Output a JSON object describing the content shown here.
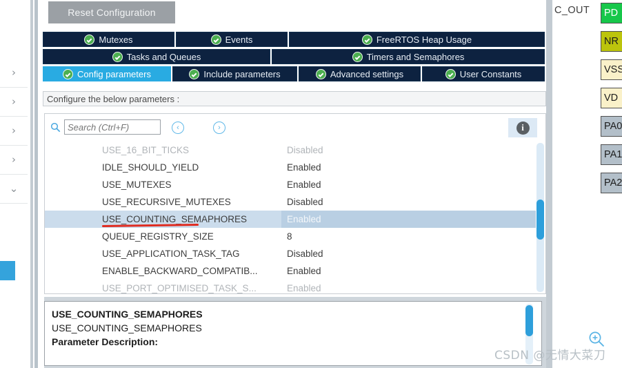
{
  "window": {
    "app": "STM32CubeMX FreeRTOS Configuration"
  },
  "toolbar": {
    "reset_label": "Reset Configuration"
  },
  "tabs": {
    "row1": [
      {
        "label": "Mutexes",
        "icon": "check-circle-icon",
        "active": false
      },
      {
        "label": "Events",
        "icon": "check-circle-icon",
        "active": false
      },
      {
        "label": "FreeRTOS Heap Usage",
        "icon": "check-circle-icon",
        "active": false
      }
    ],
    "row2": [
      {
        "label": "Tasks and Queues",
        "icon": "check-circle-icon",
        "active": false
      },
      {
        "label": "Timers and Semaphores",
        "icon": "check-circle-icon",
        "active": false
      }
    ],
    "row3": [
      {
        "label": "Config parameters",
        "icon": "check-circle-icon",
        "active": true
      },
      {
        "label": "Include parameters",
        "icon": "check-circle-icon",
        "active": false
      },
      {
        "label": "Advanced settings",
        "icon": "check-circle-icon",
        "active": false
      },
      {
        "label": "User Constants",
        "icon": "check-circle-icon",
        "active": false
      }
    ]
  },
  "configure_strip": {
    "text": "Configure the below parameters :"
  },
  "search": {
    "placeholder": "Search (Ctrl+F)",
    "prev_icon": "‹",
    "next_icon": "›",
    "info_icon": "i"
  },
  "parameters": [
    {
      "name": "USE_16_BIT_TICKS",
      "value": "Disabled",
      "state": "dim"
    },
    {
      "name": "IDLE_SHOULD_YIELD",
      "value": "Enabled",
      "state": "normal"
    },
    {
      "name": "USE_MUTEXES",
      "value": "Enabled",
      "state": "normal"
    },
    {
      "name": "USE_RECURSIVE_MUTEXES",
      "value": "Disabled",
      "state": "normal"
    },
    {
      "name": "USE_COUNTING_SEMAPHORES",
      "value": "Enabled",
      "state": "selected"
    },
    {
      "name": "QUEUE_REGISTRY_SIZE",
      "value": "8",
      "state": "normal"
    },
    {
      "name": "USE_APPLICATION_TASK_TAG",
      "value": "Disabled",
      "state": "normal"
    },
    {
      "name": "ENABLE_BACKWARD_COMPATIB...",
      "value": "Enabled",
      "state": "normal"
    },
    {
      "name": "USE_PORT_OPTIMISED_TASK_S...",
      "value": "Enabled",
      "state": "dim"
    }
  ],
  "description": {
    "title": "USE_COUNTING_SEMAPHORES",
    "subtitle": "USE_COUNTING_SEMAPHORES",
    "label": "Parameter Description:"
  },
  "pinout": {
    "net_label": "C_OUT",
    "pins": [
      {
        "label": "PD",
        "color": "#17c74a"
      },
      {
        "label": "NR",
        "color": "#bcc40c"
      },
      {
        "label": "VSS",
        "color": "#faf1c9"
      },
      {
        "label": "VD",
        "color": "#faf1c9"
      },
      {
        "label": "PA0",
        "color": "#b3bfc9"
      },
      {
        "label": "PA1",
        "color": "#b3bfc9"
      },
      {
        "label": "PA2",
        "color": "#b3bfc9"
      }
    ]
  },
  "sidebar": {
    "items": [
      {
        "icon": "chevron-right-icon",
        "expanded": false
      },
      {
        "icon": "chevron-right-icon",
        "expanded": false
      },
      {
        "icon": "chevron-right-icon",
        "expanded": false
      },
      {
        "icon": "chevron-right-icon",
        "expanded": false
      },
      {
        "icon": "chevron-down-icon",
        "expanded": true
      }
    ]
  },
  "watermark": {
    "text": "CSDN @无情大菜刀",
    "zoom_icon": "zoom-in-icon"
  },
  "colors": {
    "tab_bg": "#0d2240",
    "tab_active": "#29abe2",
    "selected_row": "#cbdcec",
    "scrollbar_thumb": "#2e9fdb",
    "annotation_red": "#e02b20",
    "reset_btn": "#9ba0a5"
  }
}
